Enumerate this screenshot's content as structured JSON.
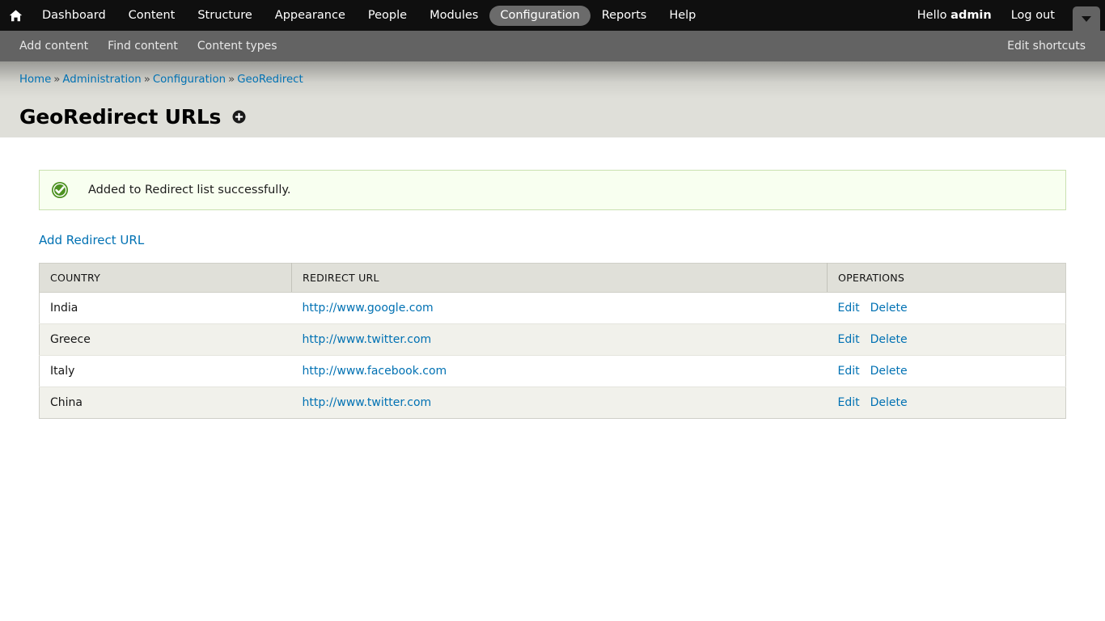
{
  "toolbar": {
    "home_icon": "home-icon",
    "items": [
      {
        "label": "Dashboard",
        "active": false
      },
      {
        "label": "Content",
        "active": false
      },
      {
        "label": "Structure",
        "active": false
      },
      {
        "label": "Appearance",
        "active": false
      },
      {
        "label": "People",
        "active": false
      },
      {
        "label": "Modules",
        "active": false
      },
      {
        "label": "Configuration",
        "active": true
      },
      {
        "label": "Reports",
        "active": false
      },
      {
        "label": "Help",
        "active": false
      }
    ],
    "greeting_prefix": "Hello ",
    "username": "admin",
    "logout_label": "Log out",
    "toggle_icon": "chevron-down-icon"
  },
  "shortcuts": {
    "items": [
      {
        "label": "Add content"
      },
      {
        "label": "Find content"
      },
      {
        "label": "Content types"
      }
    ],
    "edit_label": "Edit shortcuts"
  },
  "breadcrumb": {
    "separator": "»",
    "items": [
      {
        "label": "Home"
      },
      {
        "label": "Administration"
      },
      {
        "label": "Configuration"
      },
      {
        "label": "GeoRedirect"
      }
    ]
  },
  "page": {
    "title": "GeoRedirect URLs",
    "shortcut_add_icon": "add-shortcut-icon"
  },
  "message": {
    "icon": "success-check-icon",
    "text": "Added to Redirect list successfully.",
    "border_color": "#c9e1b0",
    "background_color": "#f8fff0",
    "icon_color": "#4d9221"
  },
  "actions": {
    "add_redirect_label": "Add Redirect URL"
  },
  "table": {
    "columns": [
      "Country",
      "Redirect URL",
      "Operations"
    ],
    "rows": [
      {
        "country": "India",
        "url": "http://www.google.com",
        "edit": "Edit",
        "delete": "Delete"
      },
      {
        "country": "Greece",
        "url": "http://www.twitter.com",
        "edit": "Edit",
        "delete": "Delete"
      },
      {
        "country": "Italy",
        "url": "http://www.facebook.com",
        "edit": "Edit",
        "delete": "Delete"
      },
      {
        "country": "China",
        "url": "http://www.twitter.com",
        "edit": "Edit",
        "delete": "Delete"
      }
    ]
  },
  "colors": {
    "toolbar_bg": "#0f0f0f",
    "shortcut_bg": "#636363",
    "header_band_bg": "#dfdfd9",
    "link": "#0071b3",
    "active_pill": "#6b6b6b"
  }
}
